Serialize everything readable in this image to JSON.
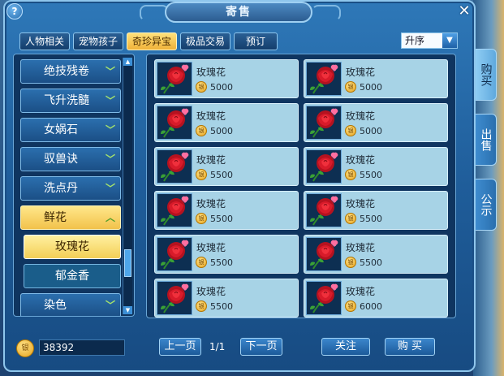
{
  "window": {
    "title": "寄售",
    "help_label": "?",
    "close_label": "✕"
  },
  "tabs": [
    {
      "label": "人物相关",
      "active": false
    },
    {
      "label": "宠物孩子",
      "active": false
    },
    {
      "label": "奇珍异宝",
      "active": true
    },
    {
      "label": "极品交易",
      "active": false
    },
    {
      "label": "预订",
      "active": false
    }
  ],
  "sort": {
    "selected": "升序",
    "arrow_icon": "chevron-down-icon"
  },
  "categories": [
    {
      "label": "绝技残卷",
      "icon": "chevron-down-icon"
    },
    {
      "label": "飞升洗髓",
      "icon": "chevron-down-icon"
    },
    {
      "label": "女娲石",
      "icon": "chevron-down-icon"
    },
    {
      "label": "驭兽诀",
      "icon": "chevron-down-icon"
    },
    {
      "label": "洗点丹",
      "icon": "chevron-down-icon"
    },
    {
      "label": "鲜花",
      "icon": "chevron-up-icon",
      "expanded": true
    },
    {
      "label": "玫瑰花",
      "sub": true,
      "selected": true
    },
    {
      "label": "郁金香",
      "sub": true
    },
    {
      "label": "染色",
      "icon": "chevron-down-icon"
    }
  ],
  "items": [
    {
      "name": "玫瑰花",
      "price": "5000"
    },
    {
      "name": "玫瑰花",
      "price": "5000"
    },
    {
      "name": "玫瑰花",
      "price": "5000"
    },
    {
      "name": "玫瑰花",
      "price": "5000"
    },
    {
      "name": "玫瑰花",
      "price": "5500"
    },
    {
      "name": "玫瑰花",
      "price": "5500"
    },
    {
      "name": "玫瑰花",
      "price": "5500"
    },
    {
      "name": "玫瑰花",
      "price": "5500"
    },
    {
      "name": "玫瑰花",
      "price": "5500"
    },
    {
      "name": "玫瑰花",
      "price": "5500"
    },
    {
      "name": "玫瑰花",
      "price": "5500"
    },
    {
      "name": "玫瑰花",
      "price": "6000"
    }
  ],
  "footer": {
    "balance": "38392",
    "prev_page": "上一页",
    "page_indicator": "1/1",
    "next_page": "下一页",
    "follow": "关注",
    "buy": "购 买"
  },
  "side_tabs": [
    {
      "label": "购买",
      "active": true
    },
    {
      "label": "出售",
      "active": false
    },
    {
      "label": "公示",
      "active": false
    }
  ],
  "colors": {
    "accent_gold": "#f0b23a",
    "panel_blue": "#1f5d9a",
    "card_bg": "#a7d3e6",
    "rose_red": "#d81b2a"
  }
}
